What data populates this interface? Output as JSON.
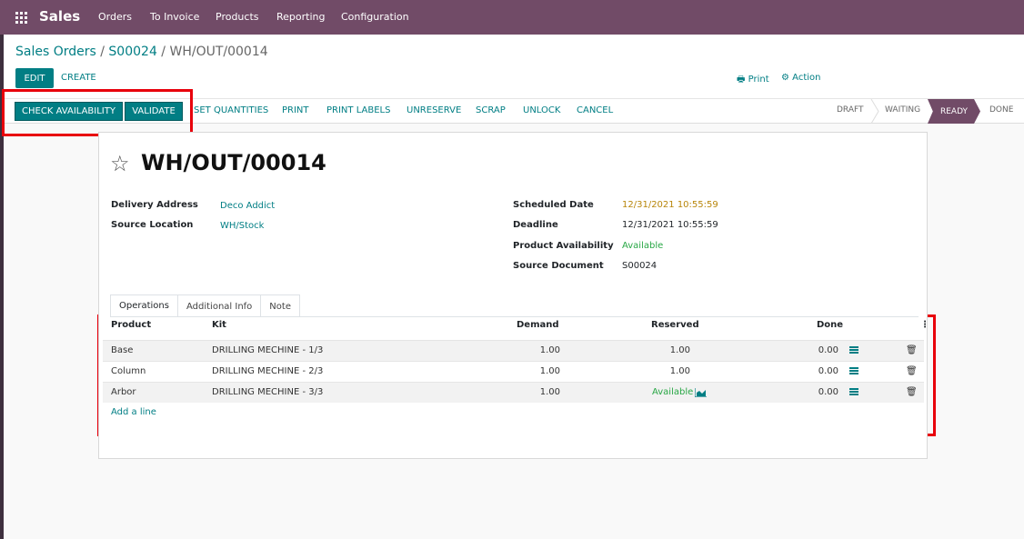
{
  "navbar": {
    "brand": "Sales",
    "menu": [
      "Orders",
      "To Invoice",
      "Products",
      "Reporting",
      "Configuration"
    ]
  },
  "breadcrumb": {
    "part1": "Sales Orders",
    "sep1": " / ",
    "part2": "S00024",
    "sep2": " / ",
    "current": "WH/OUT/00014"
  },
  "control": {
    "edit": "EDIT",
    "create": "CREATE",
    "print": "Print",
    "action": "Action"
  },
  "actions": {
    "check_availability": "CHECK AVAILABILITY",
    "validate": "VALIDATE",
    "links": [
      "SET QUANTITIES",
      "PRINT",
      "PRINT LABELS",
      "UNRESERVE",
      "SCRAP",
      "UNLOCK",
      "CANCEL"
    ]
  },
  "stages": {
    "draft": "DRAFT",
    "waiting": "WAITING",
    "ready": "READY",
    "done": "DONE",
    "current": "READY"
  },
  "record": {
    "title": "WH/OUT/00014",
    "fields": {
      "delivery_address_label": "Delivery Address",
      "delivery_address": "Deco Addict",
      "source_location_label": "Source Location",
      "source_location": "WH/Stock",
      "scheduled_date_label": "Scheduled Date",
      "scheduled_date": "12/31/2021 10:55:59",
      "deadline_label": "Deadline",
      "deadline": "12/31/2021 10:55:59",
      "availability_label": "Product Availability",
      "availability": "Available",
      "source_document_label": "Source Document",
      "source_document": "S00024"
    }
  },
  "tabs": [
    "Operations",
    "Additional Info",
    "Note"
  ],
  "table": {
    "headers": {
      "product": "Product",
      "kit": "Kit",
      "demand": "Demand",
      "reserved": "Reserved",
      "done": "Done"
    },
    "rows": [
      {
        "product": "Base",
        "kit": "DRILLING MECHINE - 1/3",
        "demand": "1.00",
        "reserved": "1.00",
        "done": "0.00"
      },
      {
        "product": "Column",
        "kit": "DRILLING MECHINE - 2/3",
        "demand": "1.00",
        "reserved": "1.00",
        "done": "0.00"
      },
      {
        "product": "Arbor",
        "kit": "DRILLING MECHINE - 3/3",
        "demand": "1.00",
        "reserved": "Available",
        "done": "0.00"
      }
    ],
    "add_line": "Add a line"
  },
  "colors": {
    "brand": "#714b67",
    "accent": "#017e84",
    "highlight": "#e8000b"
  }
}
